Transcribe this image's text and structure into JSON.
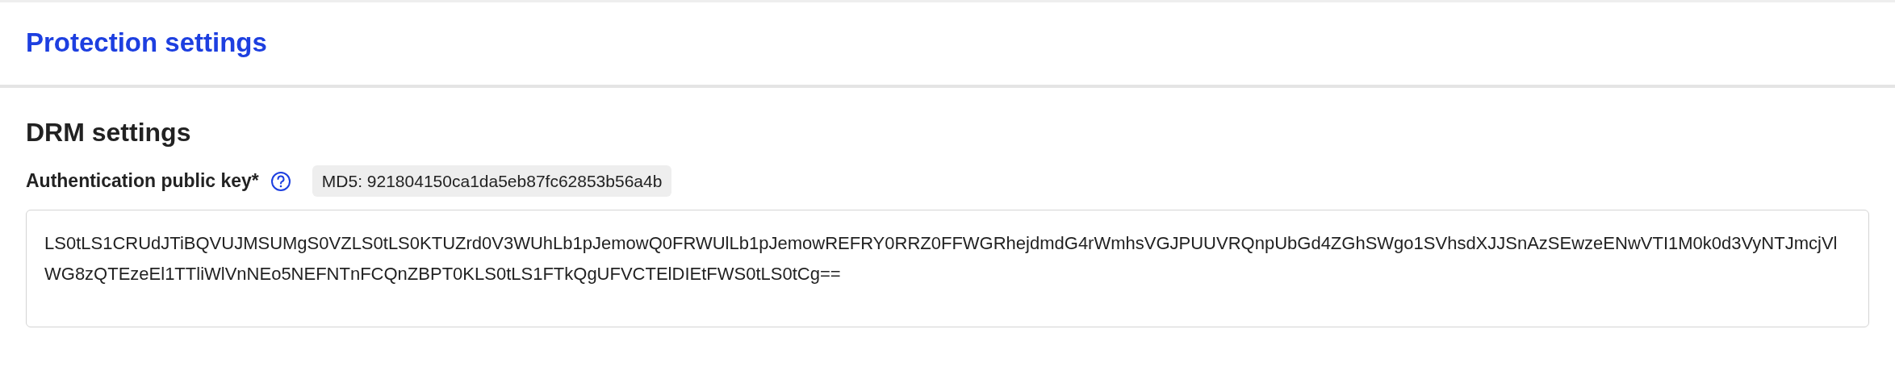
{
  "header": {
    "title": "Protection settings"
  },
  "section": {
    "title": "DRM settings",
    "field": {
      "label": "Authentication public key*",
      "md5": "MD5: 921804150ca1da5eb87fc62853b56a4b",
      "value": "LS0tLS1CRUdJTiBQVUJMSUMgS0VZLS0tLS0KTUZrd0V3WUhLb1pJemowQ0FRWUlLb1pJemowREFRY0RRZ0FFWGRhejdmdG4rWmhsVGJPUUVRQnpUbGd4ZGhSWgo1SVhsdXJJSnAzSEwzeENwVTI1M0k0d3VyNTJmcjVlWG8zQTEzeEl1TTliWlVnNEo5NEFNTnFCQnZBPT0KLS0tLS1FTkQgUFVCTElDIEtFWS0tLS0tCg=="
    }
  }
}
